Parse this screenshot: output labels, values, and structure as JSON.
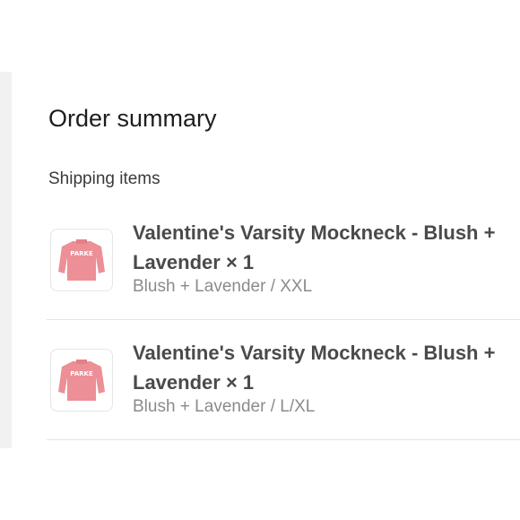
{
  "order_summary": {
    "title": "Order summary",
    "section_label": "Shipping items",
    "items": [
      {
        "name": "Valentine's Varsity Mockneck - Blush + Lavender",
        "quantity": "× 1",
        "variant": "Blush + Lavender / XXL",
        "thumbnail_icon": "pink-sweater-icon"
      },
      {
        "name": "Valentine's Varsity Mockneck - Blush + Lavender",
        "quantity": "× 1",
        "variant": "Blush + Lavender / L/XL",
        "thumbnail_icon": "pink-sweater-icon"
      }
    ]
  },
  "colors": {
    "sweater_pink": "#ec8f97",
    "sweater_text": "#ffffff",
    "divider": "#e4e4e4"
  }
}
